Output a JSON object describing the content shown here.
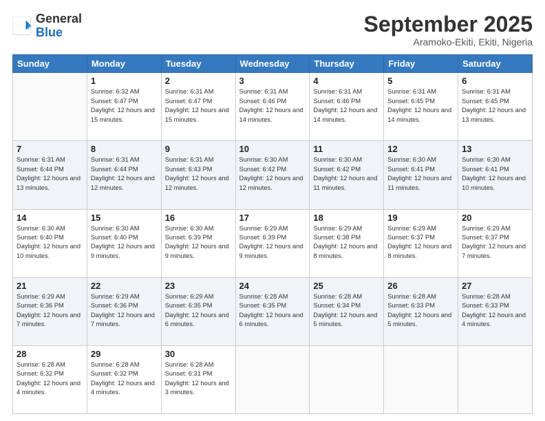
{
  "header": {
    "logo_general": "General",
    "logo_blue": "Blue",
    "month_title": "September 2025",
    "subtitle": "Aramoko-Ekiti, Ekiti, Nigeria"
  },
  "days_of_week": [
    "Sunday",
    "Monday",
    "Tuesday",
    "Wednesday",
    "Thursday",
    "Friday",
    "Saturday"
  ],
  "weeks": [
    [
      {
        "day": "",
        "sunrise": "",
        "sunset": "",
        "daylight": ""
      },
      {
        "day": "1",
        "sunrise": "Sunrise: 6:32 AM",
        "sunset": "Sunset: 6:47 PM",
        "daylight": "Daylight: 12 hours and 15 minutes."
      },
      {
        "day": "2",
        "sunrise": "Sunrise: 6:31 AM",
        "sunset": "Sunset: 6:47 PM",
        "daylight": "Daylight: 12 hours and 15 minutes."
      },
      {
        "day": "3",
        "sunrise": "Sunrise: 6:31 AM",
        "sunset": "Sunset: 6:46 PM",
        "daylight": "Daylight: 12 hours and 14 minutes."
      },
      {
        "day": "4",
        "sunrise": "Sunrise: 6:31 AM",
        "sunset": "Sunset: 6:46 PM",
        "daylight": "Daylight: 12 hours and 14 minutes."
      },
      {
        "day": "5",
        "sunrise": "Sunrise: 6:31 AM",
        "sunset": "Sunset: 6:45 PM",
        "daylight": "Daylight: 12 hours and 14 minutes."
      },
      {
        "day": "6",
        "sunrise": "Sunrise: 6:31 AM",
        "sunset": "Sunset: 6:45 PM",
        "daylight": "Daylight: 12 hours and 13 minutes."
      }
    ],
    [
      {
        "day": "7",
        "sunrise": "Sunrise: 6:31 AM",
        "sunset": "Sunset: 6:44 PM",
        "daylight": "Daylight: 12 hours and 13 minutes."
      },
      {
        "day": "8",
        "sunrise": "Sunrise: 6:31 AM",
        "sunset": "Sunset: 6:44 PM",
        "daylight": "Daylight: 12 hours and 12 minutes."
      },
      {
        "day": "9",
        "sunrise": "Sunrise: 6:31 AM",
        "sunset": "Sunset: 6:43 PM",
        "daylight": "Daylight: 12 hours and 12 minutes."
      },
      {
        "day": "10",
        "sunrise": "Sunrise: 6:30 AM",
        "sunset": "Sunset: 6:42 PM",
        "daylight": "Daylight: 12 hours and 12 minutes."
      },
      {
        "day": "11",
        "sunrise": "Sunrise: 6:30 AM",
        "sunset": "Sunset: 6:42 PM",
        "daylight": "Daylight: 12 hours and 11 minutes."
      },
      {
        "day": "12",
        "sunrise": "Sunrise: 6:30 AM",
        "sunset": "Sunset: 6:41 PM",
        "daylight": "Daylight: 12 hours and 11 minutes."
      },
      {
        "day": "13",
        "sunrise": "Sunrise: 6:30 AM",
        "sunset": "Sunset: 6:41 PM",
        "daylight": "Daylight: 12 hours and 10 minutes."
      }
    ],
    [
      {
        "day": "14",
        "sunrise": "Sunrise: 6:30 AM",
        "sunset": "Sunset: 6:40 PM",
        "daylight": "Daylight: 12 hours and 10 minutes."
      },
      {
        "day": "15",
        "sunrise": "Sunrise: 6:30 AM",
        "sunset": "Sunset: 6:40 PM",
        "daylight": "Daylight: 12 hours and 9 minutes."
      },
      {
        "day": "16",
        "sunrise": "Sunrise: 6:30 AM",
        "sunset": "Sunset: 6:39 PM",
        "daylight": "Daylight: 12 hours and 9 minutes."
      },
      {
        "day": "17",
        "sunrise": "Sunrise: 6:29 AM",
        "sunset": "Sunset: 6:39 PM",
        "daylight": "Daylight: 12 hours and 9 minutes."
      },
      {
        "day": "18",
        "sunrise": "Sunrise: 6:29 AM",
        "sunset": "Sunset: 6:38 PM",
        "daylight": "Daylight: 12 hours and 8 minutes."
      },
      {
        "day": "19",
        "sunrise": "Sunrise: 6:29 AM",
        "sunset": "Sunset: 6:37 PM",
        "daylight": "Daylight: 12 hours and 8 minutes."
      },
      {
        "day": "20",
        "sunrise": "Sunrise: 6:29 AM",
        "sunset": "Sunset: 6:37 PM",
        "daylight": "Daylight: 12 hours and 7 minutes."
      }
    ],
    [
      {
        "day": "21",
        "sunrise": "Sunrise: 6:29 AM",
        "sunset": "Sunset: 6:36 PM",
        "daylight": "Daylight: 12 hours and 7 minutes."
      },
      {
        "day": "22",
        "sunrise": "Sunrise: 6:29 AM",
        "sunset": "Sunset: 6:36 PM",
        "daylight": "Daylight: 12 hours and 7 minutes."
      },
      {
        "day": "23",
        "sunrise": "Sunrise: 6:29 AM",
        "sunset": "Sunset: 6:35 PM",
        "daylight": "Daylight: 12 hours and 6 minutes."
      },
      {
        "day": "24",
        "sunrise": "Sunrise: 6:28 AM",
        "sunset": "Sunset: 6:35 PM",
        "daylight": "Daylight: 12 hours and 6 minutes."
      },
      {
        "day": "25",
        "sunrise": "Sunrise: 6:28 AM",
        "sunset": "Sunset: 6:34 PM",
        "daylight": "Daylight: 12 hours and 5 minutes."
      },
      {
        "day": "26",
        "sunrise": "Sunrise: 6:28 AM",
        "sunset": "Sunset: 6:33 PM",
        "daylight": "Daylight: 12 hours and 5 minutes."
      },
      {
        "day": "27",
        "sunrise": "Sunrise: 6:28 AM",
        "sunset": "Sunset: 6:33 PM",
        "daylight": "Daylight: 12 hours and 4 minutes."
      }
    ],
    [
      {
        "day": "28",
        "sunrise": "Sunrise: 6:28 AM",
        "sunset": "Sunset: 6:32 PM",
        "daylight": "Daylight: 12 hours and 4 minutes."
      },
      {
        "day": "29",
        "sunrise": "Sunrise: 6:28 AM",
        "sunset": "Sunset: 6:32 PM",
        "daylight": "Daylight: 12 hours and 4 minutes."
      },
      {
        "day": "30",
        "sunrise": "Sunrise: 6:28 AM",
        "sunset": "Sunset: 6:31 PM",
        "daylight": "Daylight: 12 hours and 3 minutes."
      },
      {
        "day": "",
        "sunrise": "",
        "sunset": "",
        "daylight": ""
      },
      {
        "day": "",
        "sunrise": "",
        "sunset": "",
        "daylight": ""
      },
      {
        "day": "",
        "sunrise": "",
        "sunset": "",
        "daylight": ""
      },
      {
        "day": "",
        "sunrise": "",
        "sunset": "",
        "daylight": ""
      }
    ]
  ]
}
